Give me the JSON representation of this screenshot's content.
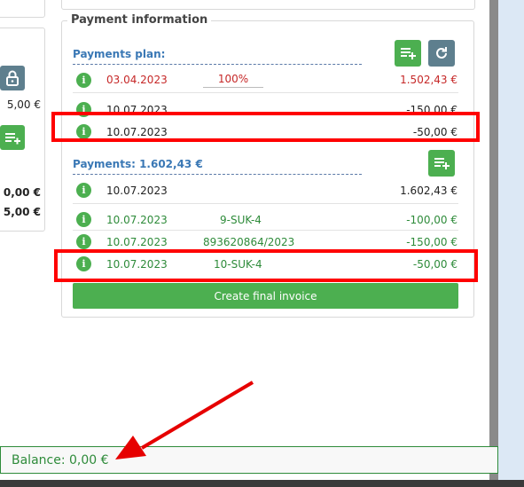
{
  "left_panel": {
    "amount_top": "5,00 €",
    "total_1": "0,00 €",
    "total_2": "5,00 €"
  },
  "payment_info": {
    "legend": "Payment information",
    "plan": {
      "title": "Payments plan:",
      "rows": [
        {
          "date": "03.04.2023",
          "percent": "100%",
          "amount": "1.502,43 €",
          "color": "#c62828"
        },
        {
          "date": "10.07.2023",
          "percent": "",
          "amount": "-150,00 €",
          "color": "#222222"
        },
        {
          "date": "10.07.2023",
          "percent": "",
          "amount": "-50,00 €",
          "color": "#222222"
        }
      ]
    },
    "payments": {
      "title": "Payments: 1.602,43 €",
      "rows": [
        {
          "date": "10.07.2023",
          "ref": "",
          "amount": "1.602,43 €",
          "color": "#222222"
        },
        {
          "date": "10.07.2023",
          "ref": "9-SUK-4",
          "amount": "-100,00 €",
          "color": "#2e8b3a"
        },
        {
          "date": "10.07.2023",
          "ref": "893620864/2023",
          "amount": "-150,00 €",
          "color": "#2e8b3a"
        },
        {
          "date": "10.07.2023",
          "ref": "10-SUK-4",
          "amount": "-50,00 €",
          "color": "#2e8b3a"
        }
      ]
    },
    "final_invoice_label": "Create final invoice"
  },
  "balance": {
    "label": "Balance: 0,00 €"
  },
  "colors": {
    "accent_green": "#4caf50",
    "slate": "#5e7f8e",
    "red": "#c62828",
    "highlight": "#ff0000",
    "link_blue": "#3a78b5"
  },
  "icons": [
    "lock-icon",
    "add-list-icon",
    "refresh-icon",
    "info-icon",
    "arrow-annotation"
  ]
}
